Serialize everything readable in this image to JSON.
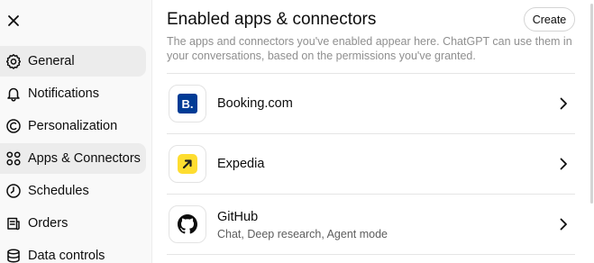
{
  "sidebar": {
    "close_icon": "close-icon",
    "items": [
      {
        "label": "General",
        "icon": "gear-icon",
        "active": true
      },
      {
        "label": "Notifications",
        "icon": "bell-icon",
        "active": false
      },
      {
        "label": "Personalization",
        "icon": "personalization-icon",
        "active": false
      },
      {
        "label": "Apps & Connectors",
        "icon": "apps-grid-icon",
        "active": true
      },
      {
        "label": "Schedules",
        "icon": "clock-icon",
        "active": false
      },
      {
        "label": "Orders",
        "icon": "orders-icon",
        "active": false
      },
      {
        "label": "Data controls",
        "icon": "data-icon",
        "active": false
      }
    ]
  },
  "main": {
    "title": "Enabled apps & connectors",
    "create_label": "Create",
    "description": "The apps and connectors you've enabled appear here. ChatGPT can use them in your conversations, based on the permissions you've granted.",
    "apps": [
      {
        "name": "Booking.com",
        "subtitle": "",
        "logo": "booking-logo",
        "logo_text": "B."
      },
      {
        "name": "Expedia",
        "subtitle": "",
        "logo": "expedia-logo"
      },
      {
        "name": "GitHub",
        "subtitle": "Chat, Deep research, Agent mode",
        "logo": "github-logo"
      }
    ]
  },
  "colors": {
    "booking_blue": "#003b95",
    "expedia_yellow": "#fedd30",
    "active_nav_bg": "#ececec",
    "sidebar_bg": "#f9f9f9"
  }
}
